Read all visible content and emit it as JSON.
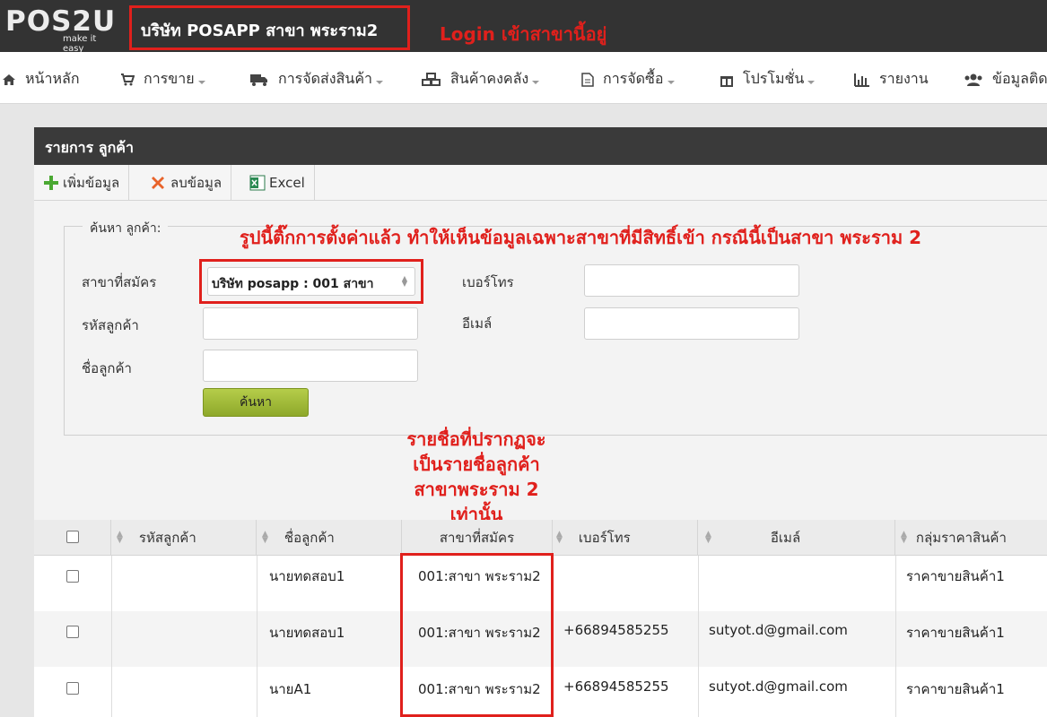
{
  "topbar": {
    "logo_text": "POS2U",
    "logo_sub": "make it easy",
    "company_name": "บริษัท POSAPP สาขา พระราม2",
    "login_note": "Login เข้าสาขานี้อยู่"
  },
  "nav": [
    {
      "label": "หน้าหลัก",
      "icon": "home-icon",
      "caret": false
    },
    {
      "label": "การขาย",
      "icon": "cart-icon",
      "caret": true
    },
    {
      "label": "การจัดส่งสินค้า",
      "icon": "truck-icon",
      "caret": true
    },
    {
      "label": "สินค้าคงคลัง",
      "icon": "boxes-icon",
      "caret": true
    },
    {
      "label": "การจัดซื้อ",
      "icon": "document-icon",
      "caret": true
    },
    {
      "label": "โปรโมชั่น",
      "icon": "gift-icon",
      "caret": true
    },
    {
      "label": "รายงาน",
      "icon": "bar-chart-icon",
      "caret": false
    },
    {
      "label": "ข้อมูลติด",
      "icon": "users-icon",
      "caret": false
    }
  ],
  "panel": {
    "title": "รายการ ลูกค้า",
    "toolbar": {
      "add_label": "เพิ่มข้อมูล",
      "delete_label": "ลบข้อมูล",
      "excel_label": "Excel"
    }
  },
  "search": {
    "legend": "ค้นหา ลูกค้า:",
    "rule_note": "รูปนี้ติ๊กการตั้งค่าแล้ว ทำให้เห็นข้อมูลเฉพาะสาขาที่มีสิทธิ์เข้า กรณีนี้เป็นสาขา พระราม 2",
    "branch_label": "สาขาที่สมัคร",
    "branch_value": "บริษัท posapp : 001 สาขา",
    "code_label": "รหัสลูกค้า",
    "name_label": "ชื่อลูกค้า",
    "phone_label": "เบอร์โทร",
    "email_label": "อีเมล์",
    "search_button": "ค้นหา"
  },
  "list_note": [
    "รายชื่อที่ปรากฏจะ",
    "เป็นรายชื่อลูกค้า",
    "สาขาพระราม 2",
    "เท่านั้น"
  ],
  "table": {
    "headers": {
      "code": "รหัสลูกค้า",
      "name": "ชื่อลูกค้า",
      "branch": "สาขาที่สมัคร",
      "phone": "เบอร์โทร",
      "email": "อีเมล์",
      "price_group": "กลุ่มราคาสินค้า"
    },
    "rows": [
      {
        "code": "",
        "name": "นายทดสอบ1",
        "branch": "001:สาขา พระราม2",
        "phone": "",
        "email": "",
        "price_group": "ราคาขายสินค้า1"
      },
      {
        "code": "",
        "name": "นายทดสอบ1",
        "branch": "001:สาขา พระราม2",
        "phone": "+66894585255",
        "email": "sutyot.d@gmail.com",
        "price_group": "ราคาขายสินค้า1"
      },
      {
        "code": "",
        "name": "นายA1",
        "branch": "001:สาขา พระราม2",
        "phone": "+66894585255",
        "email": "sutyot.d@gmail.com",
        "price_group": "ราคาขายสินค้า1"
      }
    ]
  },
  "colors": {
    "accent_red": "#e0201c",
    "topbar": "#333333",
    "search_button": "#9ab83a"
  }
}
